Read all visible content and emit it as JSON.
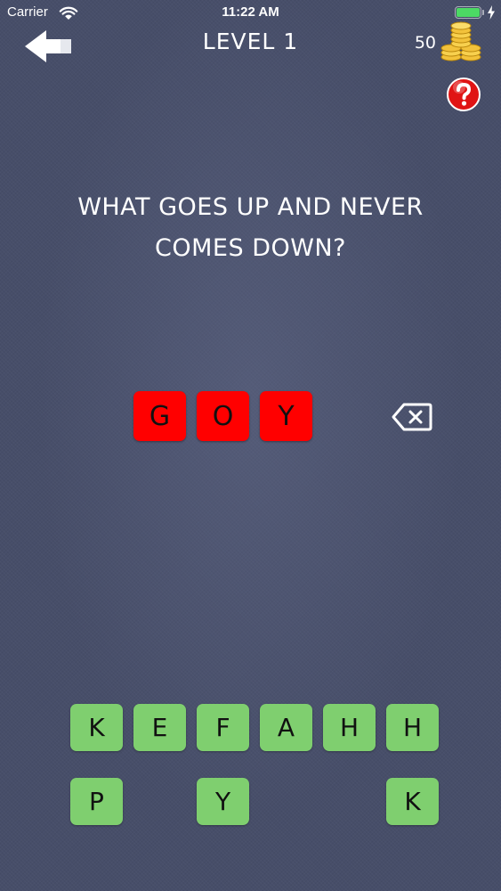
{
  "status_bar": {
    "carrier": "Carrier",
    "time": "11:22 AM",
    "battery_level": 1.0,
    "battery_color": "#4cd964"
  },
  "header": {
    "back_icon": "arrow-left-icon",
    "level_title": "LEVEL 1",
    "coins": "50",
    "coins_icon": "coin-stack-icon",
    "help_icon": "question-mark-icon"
  },
  "question": {
    "text": "WHAT GOES UP AND NEVER COMES DOWN?"
  },
  "answer": {
    "slots": [
      "G",
      "O",
      "Y"
    ],
    "slot_color": "#ff0000",
    "backspace_icon": "backspace-icon"
  },
  "keyboard": {
    "key_color": "#7fcf6f",
    "rows": [
      [
        "K",
        "E",
        "F",
        "A",
        "H",
        "H"
      ],
      [
        "P",
        "",
        "Y",
        "",
        "",
        "K"
      ]
    ]
  }
}
